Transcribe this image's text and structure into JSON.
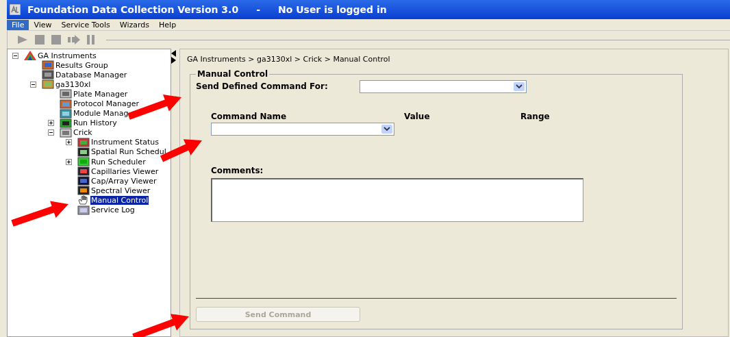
{
  "window": {
    "title": "Foundation Data Collection Version 3.0",
    "separator": "-",
    "user_status": "No User is logged in"
  },
  "menu": [
    {
      "label": "File",
      "selected": true
    },
    {
      "label": "View",
      "selected": false
    },
    {
      "label": "Service Tools",
      "selected": false
    },
    {
      "label": "Wizards",
      "selected": false
    },
    {
      "label": "Help",
      "selected": false
    }
  ],
  "toolbar": [
    {
      "kind": "play"
    },
    {
      "kind": "stop"
    },
    {
      "kind": "stop"
    },
    {
      "kind": "skip"
    },
    {
      "kind": "pause"
    }
  ],
  "tree": [
    {
      "label": "GA Instruments",
      "kind": "prism",
      "expanded": true,
      "selected": false,
      "children": [
        {
          "label": "Results Group",
          "kind": "results",
          "selected": false
        },
        {
          "label": "Database Manager",
          "kind": "database",
          "selected": false
        },
        {
          "label": "ga3130xl",
          "kind": "instrument",
          "expanded": true,
          "selected": false,
          "children": [
            {
              "label": "Plate Manager",
              "kind": "plate",
              "selected": false
            },
            {
              "label": "Protocol Manager",
              "kind": "protocol",
              "selected": false
            },
            {
              "label": "Module Manag",
              "kind": "module",
              "selected": false
            },
            {
              "label": "Run History",
              "kind": "history",
              "expanded": false,
              "selected": false
            },
            {
              "label": "Crick",
              "kind": "crick",
              "expanded": true,
              "selected": false,
              "children": [
                {
                  "label": "Instrument Status",
                  "kind": "status",
                  "expanded": false,
                  "selected": false
                },
                {
                  "label": "Spatial Run Schedul",
                  "kind": "spatial",
                  "selected": false
                },
                {
                  "label": "Run Scheduler",
                  "kind": "scheduler",
                  "expanded": false,
                  "selected": false
                },
                {
                  "label": "Capillaries Viewer",
                  "kind": "viewer",
                  "selected": false
                },
                {
                  "label": "Cap/Array Viewer",
                  "kind": "array",
                  "selected": false
                },
                {
                  "label": "Spectral Viewer",
                  "kind": "spectral",
                  "selected": false
                },
                {
                  "label": "Manual Control",
                  "kind": "hand",
                  "selected": true
                },
                {
                  "label": "Service Log",
                  "kind": "log",
                  "selected": false
                }
              ]
            }
          ]
        }
      ]
    }
  ],
  "breadcrumb": "GA Instruments > ga3130xl > Crick > Manual Control",
  "panel": {
    "title": "Manual Control",
    "send_for_label": "Send Defined Command For:",
    "columns": [
      "Command Name",
      "Value",
      "Range"
    ],
    "comments_label": "Comments:",
    "send_button": {
      "label": "Send Command",
      "disabled": true
    }
  }
}
